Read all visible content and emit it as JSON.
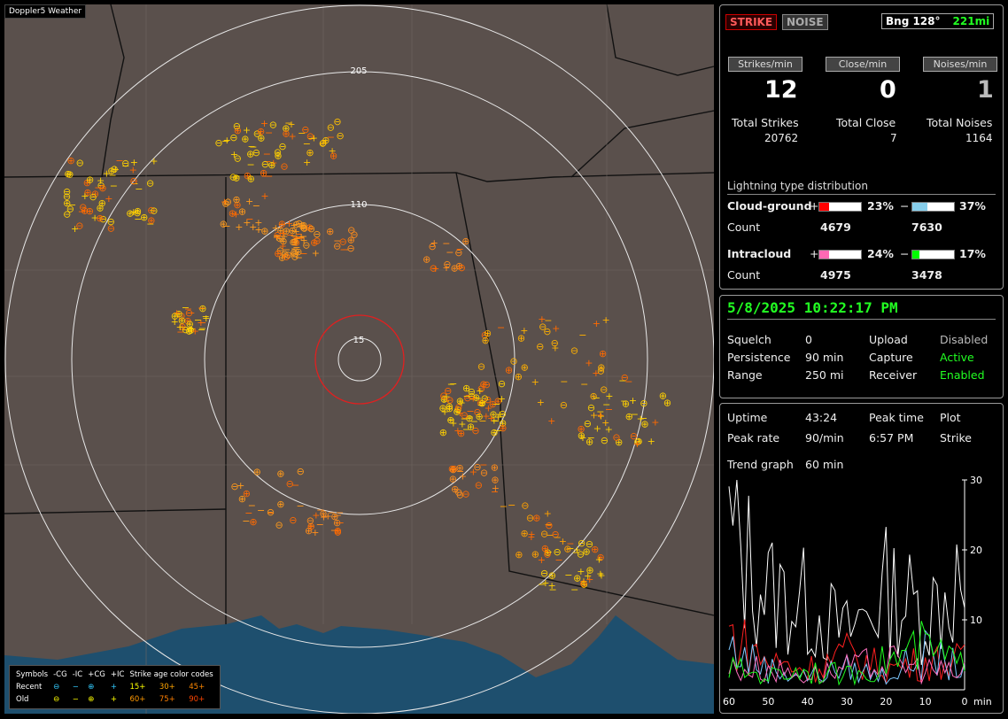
{
  "map": {
    "title": "Doppler5 Weather",
    "ring_labels": [
      "205",
      "110",
      "15"
    ]
  },
  "legend": {
    "header": [
      "Symbols",
      "-CG",
      "-IC",
      "+CG",
      "+IC",
      "Strike age color codes"
    ],
    "recent_label": "Recent",
    "old_label": "Old",
    "recent_ages": [
      "15+",
      "30+",
      "45+"
    ],
    "old_ages": [
      "60+",
      "75+",
      "90+"
    ],
    "age_colors": [
      "#ffff00",
      "#ffa500",
      "#ff8800",
      "#ffffaa",
      "#ff7f00",
      "#ff4500"
    ]
  },
  "stats": {
    "strike_button": "STRIKE",
    "noise_button": "NOISE",
    "bearing": "Bng 128°",
    "range_mi": "221mi",
    "strikes_per_min_label": "Strikes/min",
    "close_per_min_label": "Close/min",
    "noises_per_min_label": "Noises/min",
    "strikes_per_min": "12",
    "close_per_min": "0",
    "noises_per_min": "1",
    "total_strikes_label": "Total Strikes",
    "total_close_label": "Total Close",
    "total_noises_label": "Total Noises",
    "total_strikes": "20762",
    "total_close": "7",
    "total_noises": "1164"
  },
  "distribution": {
    "title": "Lightning type distribution",
    "cg_label": "Cloud-ground",
    "ic_label": "Intracloud",
    "count_label": "Count",
    "plus": "+",
    "minus": "−",
    "cg_plus_pct": "23%",
    "cg_minus_pct": "37%",
    "ic_plus_pct": "24%",
    "ic_minus_pct": "17%",
    "cg_plus_fraction": 0.23,
    "cg_minus_fraction": 0.37,
    "ic_plus_fraction": 0.24,
    "ic_minus_fraction": 0.17,
    "cg_plus_count": "4679",
    "cg_minus_count": "7630",
    "ic_plus_count": "4975",
    "ic_minus_count": "3478",
    "colors": {
      "cg_plus": "#ff0000",
      "cg_minus": "#87ceeb",
      "ic_plus": "#ff69b4",
      "ic_minus": "#00ff00"
    }
  },
  "status": {
    "datetime": "5/8/2025 10:22:17 PM",
    "squelch_label": "Squelch",
    "squelch": "0",
    "persistence_label": "Persistence",
    "persistence": "90 min",
    "range_label": "Range",
    "range": "250 mi",
    "upload_label": "Upload",
    "upload": "Disabled",
    "capture_label": "Capture",
    "capture": "Active",
    "receiver_label": "Receiver",
    "receiver": "Enabled"
  },
  "trend": {
    "uptime_label": "Uptime",
    "uptime": "43:24",
    "peak_time_label": "Peak time",
    "peak_time": "6:57 PM",
    "plot_label": "Plot",
    "peak_rate_label": "Peak rate",
    "peak_rate": "90/min",
    "plot_type": "Strike",
    "trend_graph_label": "Trend graph",
    "trend_graph_span": "60 min",
    "y_ticks": [
      "30",
      "20",
      "10"
    ],
    "x_ticks": [
      "60",
      "50",
      "40",
      "30",
      "20",
      "10",
      "0"
    ],
    "x_unit": "min"
  },
  "chart_data": {
    "type": "line",
    "ylim": [
      0,
      30
    ],
    "x": [
      60,
      50,
      40,
      30,
      20,
      10,
      0
    ],
    "series": [
      {
        "values": [
          22,
          14,
          12,
          8,
          14,
          11,
          16
        ]
      },
      {
        "values": [
          8,
          4,
          3,
          5,
          3,
          4,
          4
        ]
      },
      {
        "values": [
          6,
          3,
          2,
          3,
          2,
          5,
          3
        ]
      },
      {
        "values": [
          3,
          3,
          2,
          3,
          4,
          3,
          2
        ]
      },
      {
        "values": [
          3,
          2,
          3,
          2,
          4,
          6,
          3
        ]
      }
    ]
  }
}
